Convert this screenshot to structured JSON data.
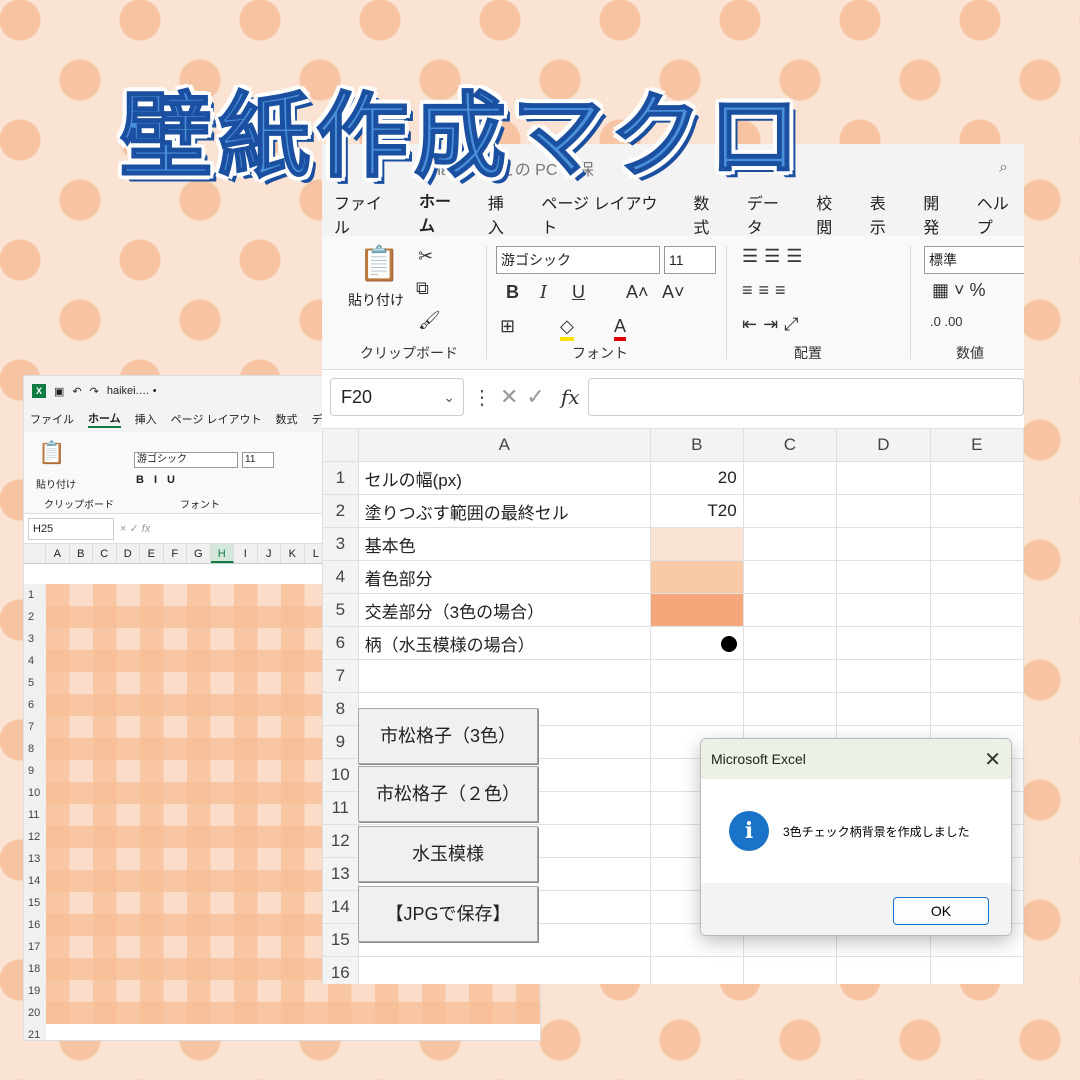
{
  "title": "壁紙作成マクロ",
  "small_window": {
    "filename": "haikei.…  • ",
    "tabs": [
      "ファイル",
      "ホーム",
      "挿入",
      "ページ レイアウト",
      "数式",
      "データ"
    ],
    "font_name": "游ゴシック",
    "font_size": "11",
    "group_clipboard": "クリップボード",
    "group_font": "フォント",
    "paste_label": "貼り付け",
    "name_box": "H25",
    "columns": [
      "A",
      "B",
      "C",
      "D",
      "E",
      "F",
      "G",
      "H",
      "I",
      "J",
      "K",
      "L"
    ],
    "rows": [
      "1",
      "2",
      "3",
      "4",
      "5",
      "6",
      "7",
      "8",
      "9",
      "10",
      "11",
      "12",
      "13",
      "14",
      "15",
      "16",
      "17",
      "18",
      "19",
      "20",
      "21"
    ]
  },
  "big_window": {
    "filename": "haikei.…  この PC に保",
    "tabs": [
      "ファイル",
      "ホーム",
      "挿入",
      "ページ レイアウト",
      "数式",
      "データ",
      "校閲",
      "表示",
      "開発",
      "ヘルプ"
    ],
    "paste_label": "貼り付け",
    "font_name": "游ゴシック",
    "font_size": "11",
    "number_format": "標準",
    "group_clipboard": "クリップボード",
    "group_font": "フォント",
    "group_alignment": "配置",
    "group_number": "数値",
    "name_box": "F20",
    "fx": "fx",
    "columns": [
      "A",
      "B",
      "C",
      "D",
      "E"
    ],
    "rows": [
      {
        "n": "1",
        "a": "セルの幅(px)",
        "b": "20"
      },
      {
        "n": "2",
        "a": "塗りつぶす範囲の最終セル",
        "b": "T20"
      },
      {
        "n": "3",
        "a": "基本色",
        "b": ""
      },
      {
        "n": "4",
        "a": "着色部分",
        "b": ""
      },
      {
        "n": "5",
        "a": "交差部分（3色の場合）",
        "b": ""
      },
      {
        "n": "6",
        "a": "柄（水玉模様の場合）",
        "b": ""
      },
      {
        "n": "7",
        "a": "",
        "b": ""
      },
      {
        "n": "8",
        "a": "",
        "b": ""
      },
      {
        "n": "9",
        "a": "",
        "b": ""
      },
      {
        "n": "10",
        "a": "",
        "b": ""
      },
      {
        "n": "11",
        "a": "",
        "b": ""
      },
      {
        "n": "12",
        "a": "",
        "b": ""
      },
      {
        "n": "13",
        "a": "",
        "b": ""
      },
      {
        "n": "14",
        "a": "",
        "b": ""
      },
      {
        "n": "15",
        "a": "",
        "b": ""
      },
      {
        "n": "16",
        "a": "",
        "b": ""
      }
    ],
    "colors": {
      "base": "#fbe3d4",
      "colored": "#f9caa8",
      "cross": "#f4a77a"
    }
  },
  "macro_buttons": [
    "市松格子（3色）",
    "市松格子（２色）",
    "水玉模様",
    "【JPGで保存】"
  ],
  "dialog": {
    "title": "Microsoft Excel",
    "message": "3色チェック柄背景を作成しました",
    "ok": "OK"
  }
}
